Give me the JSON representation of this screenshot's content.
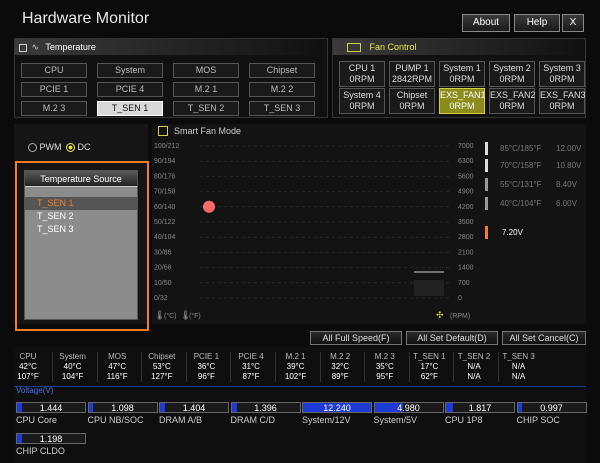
{
  "window": {
    "title": "Hardware Monitor",
    "about": "About",
    "help": "Help",
    "close": "X"
  },
  "temperature": {
    "header": "Temperature",
    "sources": [
      "CPU",
      "System",
      "MOS",
      "Chipset",
      "PCIE 1",
      "PCIE 4",
      "M.2 1",
      "M.2 2",
      "M.2 3",
      "T_SEN 1",
      "T_SEN 2",
      "T_SEN 3"
    ],
    "selected": "T_SEN 1"
  },
  "fan_control": {
    "header": "Fan Control",
    "fans": [
      {
        "name": "CPU 1",
        "rpm": "0RPM"
      },
      {
        "name": "PUMP 1",
        "rpm": "2842RPM"
      },
      {
        "name": "System 1",
        "rpm": "0RPM"
      },
      {
        "name": "System 2",
        "rpm": "0RPM"
      },
      {
        "name": "System 3",
        "rpm": "0RPM"
      },
      {
        "name": "System 4",
        "rpm": "0RPM"
      },
      {
        "name": "Chipset",
        "rpm": "0RPM"
      },
      {
        "name": "EXS_FAN1",
        "rpm": "0RPM"
      },
      {
        "name": "EXS_FAN2",
        "rpm": "0RPM"
      },
      {
        "name": "EXS_FAN3",
        "rpm": "0RPM"
      }
    ],
    "selected": "EXS_FAN1"
  },
  "mode": {
    "pwm": "PWM",
    "dc": "DC",
    "selected": "DC"
  },
  "temp_source": {
    "title": "Temperature Source",
    "items": [
      "T_SEN 1",
      "T_SEN 2",
      "T_SEN 3"
    ],
    "selected": "T_SEN 1"
  },
  "smart_fan": {
    "label": "Smart Fan Mode"
  },
  "chart_data": {
    "type": "line",
    "y_left_ticks": [
      "100/212",
      "90/194",
      "80/176",
      "70/158",
      "60/140",
      "50/122",
      "40/104",
      "30/86",
      "20/68",
      "10/50",
      "0/32"
    ],
    "y_right_ticks": [
      "7000",
      "6300",
      "5600",
      "4900",
      "4200",
      "3500",
      "2800",
      "2100",
      "1400",
      "700",
      "0"
    ],
    "points": [
      {
        "temp_c": 60,
        "rpm": 4200
      }
    ],
    "legend_left_c": "(°C)",
    "legend_left_f": "(°F)",
    "legend_right": "(RPM)"
  },
  "levels": [
    {
      "temp": "85°C/185°F",
      "volt": "12.00V",
      "active": false
    },
    {
      "temp": "70°C/158°F",
      "volt": "10.80V",
      "active": false
    },
    {
      "temp": "55°C/131°F",
      "volt": "8.40V",
      "active": false
    },
    {
      "temp": "40°C/104°F",
      "volt": "6.00V",
      "active": false
    },
    {
      "temp": "",
      "volt": "7.20V",
      "active": true
    }
  ],
  "buttons": {
    "full_speed": "All Full Speed(F)",
    "set_default": "All Set Default(D)",
    "set_cancel": "All Set Cancel(C)"
  },
  "sensors": [
    {
      "name": "CPU",
      "c": "42°C",
      "f": "107°F"
    },
    {
      "name": "System",
      "c": "40°C",
      "f": "104°F"
    },
    {
      "name": "MOS",
      "c": "47°C",
      "f": "116°F"
    },
    {
      "name": "Chipset",
      "c": "53°C",
      "f": "127°F"
    },
    {
      "name": "PCIE 1",
      "c": "36°C",
      "f": "96°F"
    },
    {
      "name": "PCIE 4",
      "c": "31°C",
      "f": "87°F"
    },
    {
      "name": "M.2 1",
      "c": "39°C",
      "f": "102°F"
    },
    {
      "name": "M.2 2",
      "c": "32°C",
      "f": "89°F"
    },
    {
      "name": "M.2 3",
      "c": "35°C",
      "f": "95°F"
    },
    {
      "name": "T_SEN 1",
      "c": "17°C",
      "f": "62°F"
    },
    {
      "name": "T_SEN 2",
      "c": "N/A",
      "f": "N/A"
    },
    {
      "name": "T_SEN 3",
      "c": "N/A",
      "f": "N/A"
    }
  ],
  "voltage": {
    "title": "Voltage(V)",
    "items": [
      {
        "name": "CPU Core",
        "value": "1.444",
        "fill": 0.08
      },
      {
        "name": "CPU NB/SOC",
        "value": "1.098",
        "fill": 0.06
      },
      {
        "name": "DRAM A/B",
        "value": "1.404",
        "fill": 0.08
      },
      {
        "name": "DRAM C/D",
        "value": "1.396",
        "fill": 0.08
      },
      {
        "name": "System/12V",
        "value": "12.240",
        "fill": 1.0
      },
      {
        "name": "System/5V",
        "value": "4.980",
        "fill": 0.42
      },
      {
        "name": "CPU 1P8",
        "value": "1.817",
        "fill": 0.1
      },
      {
        "name": "CHIP SOC",
        "value": "0.997",
        "fill": 0.06
      },
      {
        "name": "CHIP CLDO",
        "value": "1.198",
        "fill": 0.07
      }
    ]
  },
  "colors": {
    "accent": "#e8e84a",
    "fan_selected": "#8c8c1c",
    "voltage_bar": "#1f3bd6",
    "highlight": "#f07e26",
    "point": "#ff6a6a"
  }
}
